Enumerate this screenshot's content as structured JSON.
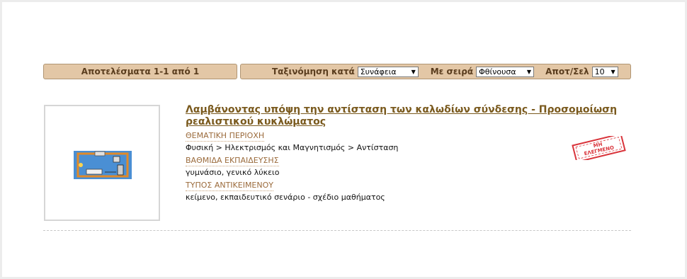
{
  "results_bar": {
    "text": "Αποτελέσματα 1-1 από 1"
  },
  "sort_bar": {
    "sort_by_label": "Ταξινόμηση κατά",
    "sort_by_value": "Συνάφεια",
    "order_label": "Με σειρά",
    "order_value": "Φθίνουσα",
    "per_page_label": "Αποτ/Σελ",
    "per_page_value": "10"
  },
  "result": {
    "title": "Λαμβάνοντας υπόψη την αντίσταση των καλωδίων σύνδεσης - Προσομοίωση ρεαλιστικού κυκλώματος",
    "fields": [
      {
        "label": "ΘΕΜΑΤΙΚΗ ΠΕΡΙΟΧΗ",
        "value": "Φυσική > Ηλεκτρισμός και Μαγνητισμός > Αντίσταση"
      },
      {
        "label": "ΒΑΘΜΙΔΑ ΕΚΠΑΙΔΕΥΣΗΣ",
        "value": "γυμνάσιο, γενικό λύκειο"
      },
      {
        "label": "ΤΥΠΟΣ ΑΝΤΙΚΕΙΜΕΝΟΥ",
        "value": "κείμενο, εκπαιδευτικό σενάριο - σχέδιο μαθήματος"
      }
    ],
    "stamp_text_line1": "ΜΗ",
    "stamp_text_line2": "ΕΛΕΓΜΕΝΟ"
  },
  "colors": {
    "bar_bg": "#e3c7a6",
    "bar_text": "#5a3d1e",
    "title": "#7a5a1e",
    "label": "#9b6b3c",
    "stamp": "#d9343b"
  }
}
